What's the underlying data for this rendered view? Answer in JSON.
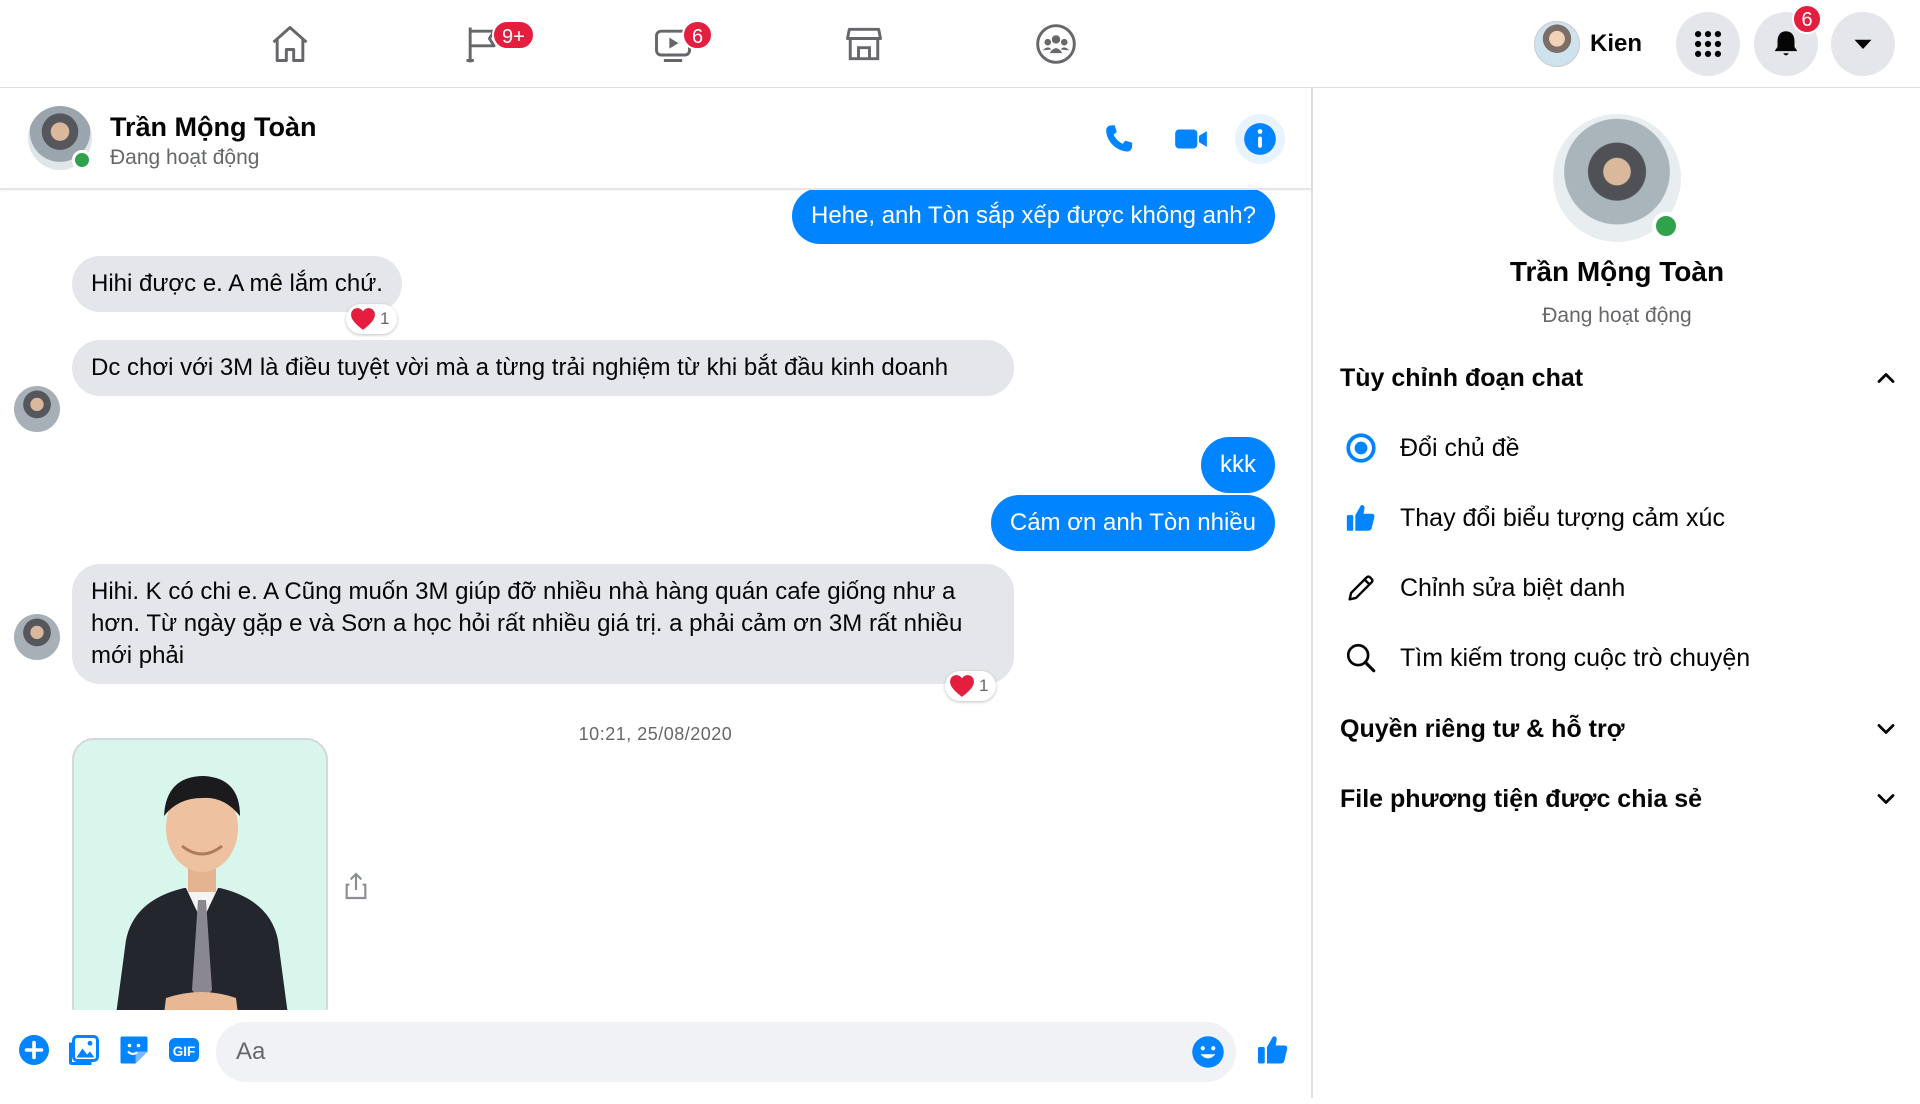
{
  "nav": {
    "tabs": [
      {
        "name": "home",
        "badge": ""
      },
      {
        "name": "pages",
        "badge": "9+"
      },
      {
        "name": "watch",
        "badge": "6"
      },
      {
        "name": "marketplace",
        "badge": ""
      },
      {
        "name": "groups",
        "badge": ""
      }
    ],
    "profile_name": "Kien",
    "notifications_badge": "6"
  },
  "chat": {
    "contact_name": "Trần Mộng Toàn",
    "contact_status": "Đang hoạt động",
    "messages": {
      "m1": "Hehe, anh Tòn sắp xếp được không anh?",
      "m2": "Hihi được e. A mê lắm chứ.",
      "m2_reaction_count": "1",
      "m3": "Dc chơi với 3M là điều tuyệt vời mà a từng trải nghiệm từ khi bắt đầu kinh doanh",
      "m4": "kkk",
      "m5": "Cám ơn anh Tòn nhiều",
      "m6": "Hihi. K có chi e. A Cũng muốn 3M giúp đỡ nhiều nhà hàng quán cafe giống như a hơn. Từ ngày gặp e và Sơn a học hỏi rất nhiều giá trị. a phải cảm ơn 3M rất nhiều mới phải",
      "m6_reaction_count": "1"
    },
    "timestamp": "10:21, 25/08/2020",
    "composer_placeholder": "Aa",
    "colors": {
      "accent": "#0084ff",
      "incoming": "#e4e6eb",
      "reaction": "#e41e3f",
      "online": "#31a24c"
    }
  },
  "info": {
    "name": "Trần Mộng Toàn",
    "status": "Đang hoạt động",
    "customize_title": "Tùy chỉnh đoạn chat",
    "options": {
      "theme": "Đổi chủ đề",
      "emoji": "Thay đổi biểu tượng cảm xúc",
      "nickname": "Chỉnh sửa biệt danh",
      "search": "Tìm kiếm trong cuộc trò chuyện"
    },
    "privacy_title": "Quyền riêng tư & hỗ trợ",
    "media_title": "File phương tiện được chia sẻ"
  }
}
